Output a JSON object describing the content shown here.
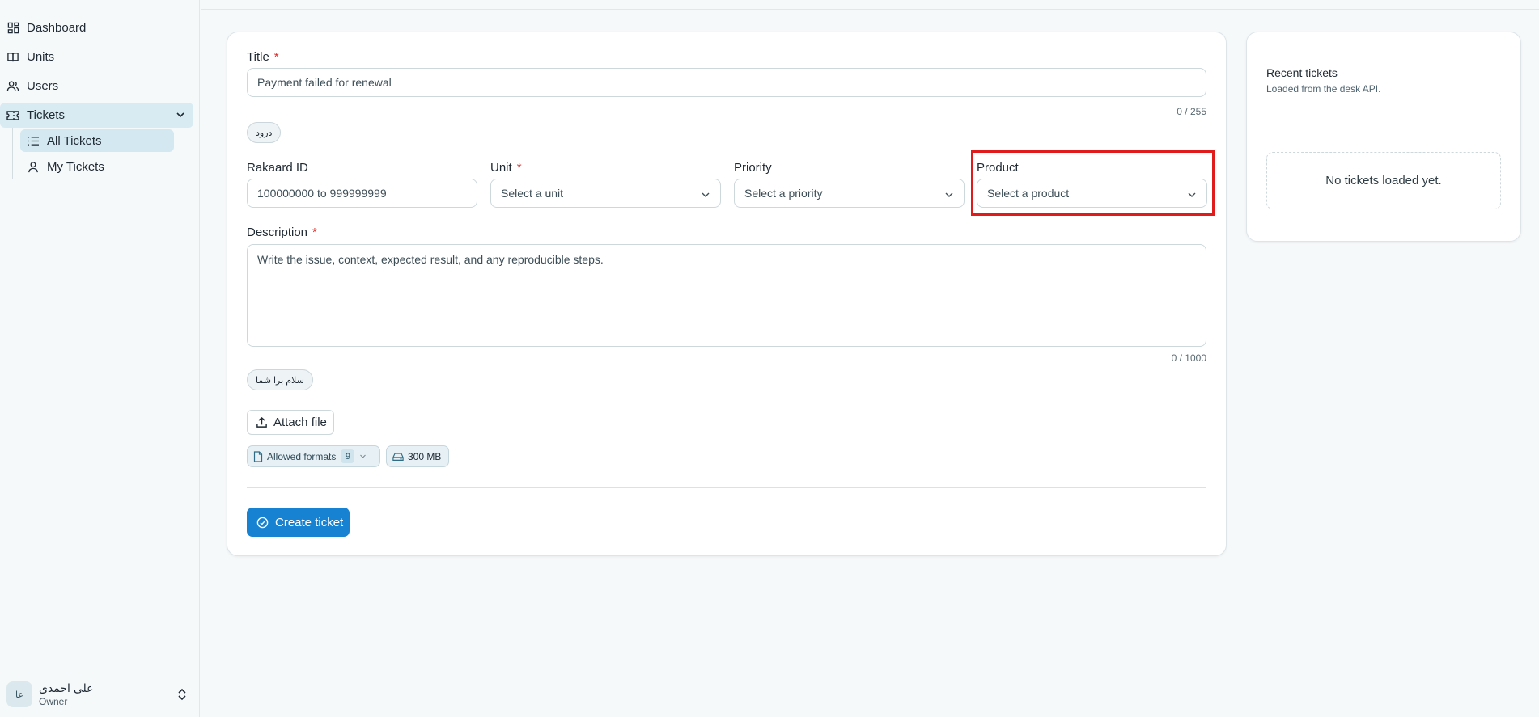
{
  "sidebar": {
    "items": [
      {
        "label": "Dashboard",
        "icon": "dashboard-icon"
      },
      {
        "label": "Units",
        "icon": "book-icon"
      },
      {
        "label": "Users",
        "icon": "users-icon"
      },
      {
        "label": "Tickets",
        "icon": "ticket-icon"
      }
    ],
    "subitems": [
      {
        "label": "All Tickets",
        "icon": "list-icon"
      },
      {
        "label": "My Tickets",
        "icon": "user-icon"
      }
    ],
    "user": {
      "initials": "عا",
      "name": "علی احمدی",
      "role": "Owner"
    }
  },
  "form": {
    "title_label": "Title",
    "title_value": "Payment failed for renewal",
    "title_counter": "0 / 255",
    "title_chip": "درود",
    "rakaard_label": "Rakaard ID",
    "rakaard_placeholder": "100000000 to 999999999",
    "unit_label": "Unit",
    "unit_placeholder": "Select a unit",
    "priority_label": "Priority",
    "priority_placeholder": "Select a priority",
    "product_label": "Product",
    "product_placeholder": "Select a product",
    "description_label": "Description",
    "description_placeholder": "Write the issue, context, expected result, and any reproducible steps.",
    "description_counter": "0 / 1000",
    "description_chip": "سلام برا شما",
    "required_mark": "*",
    "attach_label": "Attach file",
    "formats_label": "Allowed formats",
    "formats_count": "9",
    "size_limit": "300 MB",
    "create_label": "Create ticket"
  },
  "recent": {
    "title": "Recent tickets",
    "subtitle": "Loaded from the desk API.",
    "empty": "No tickets loaded yet."
  },
  "colors": {
    "accent": "#1782d1",
    "highlight": "#e01b1b",
    "required": "#d92d2d"
  }
}
